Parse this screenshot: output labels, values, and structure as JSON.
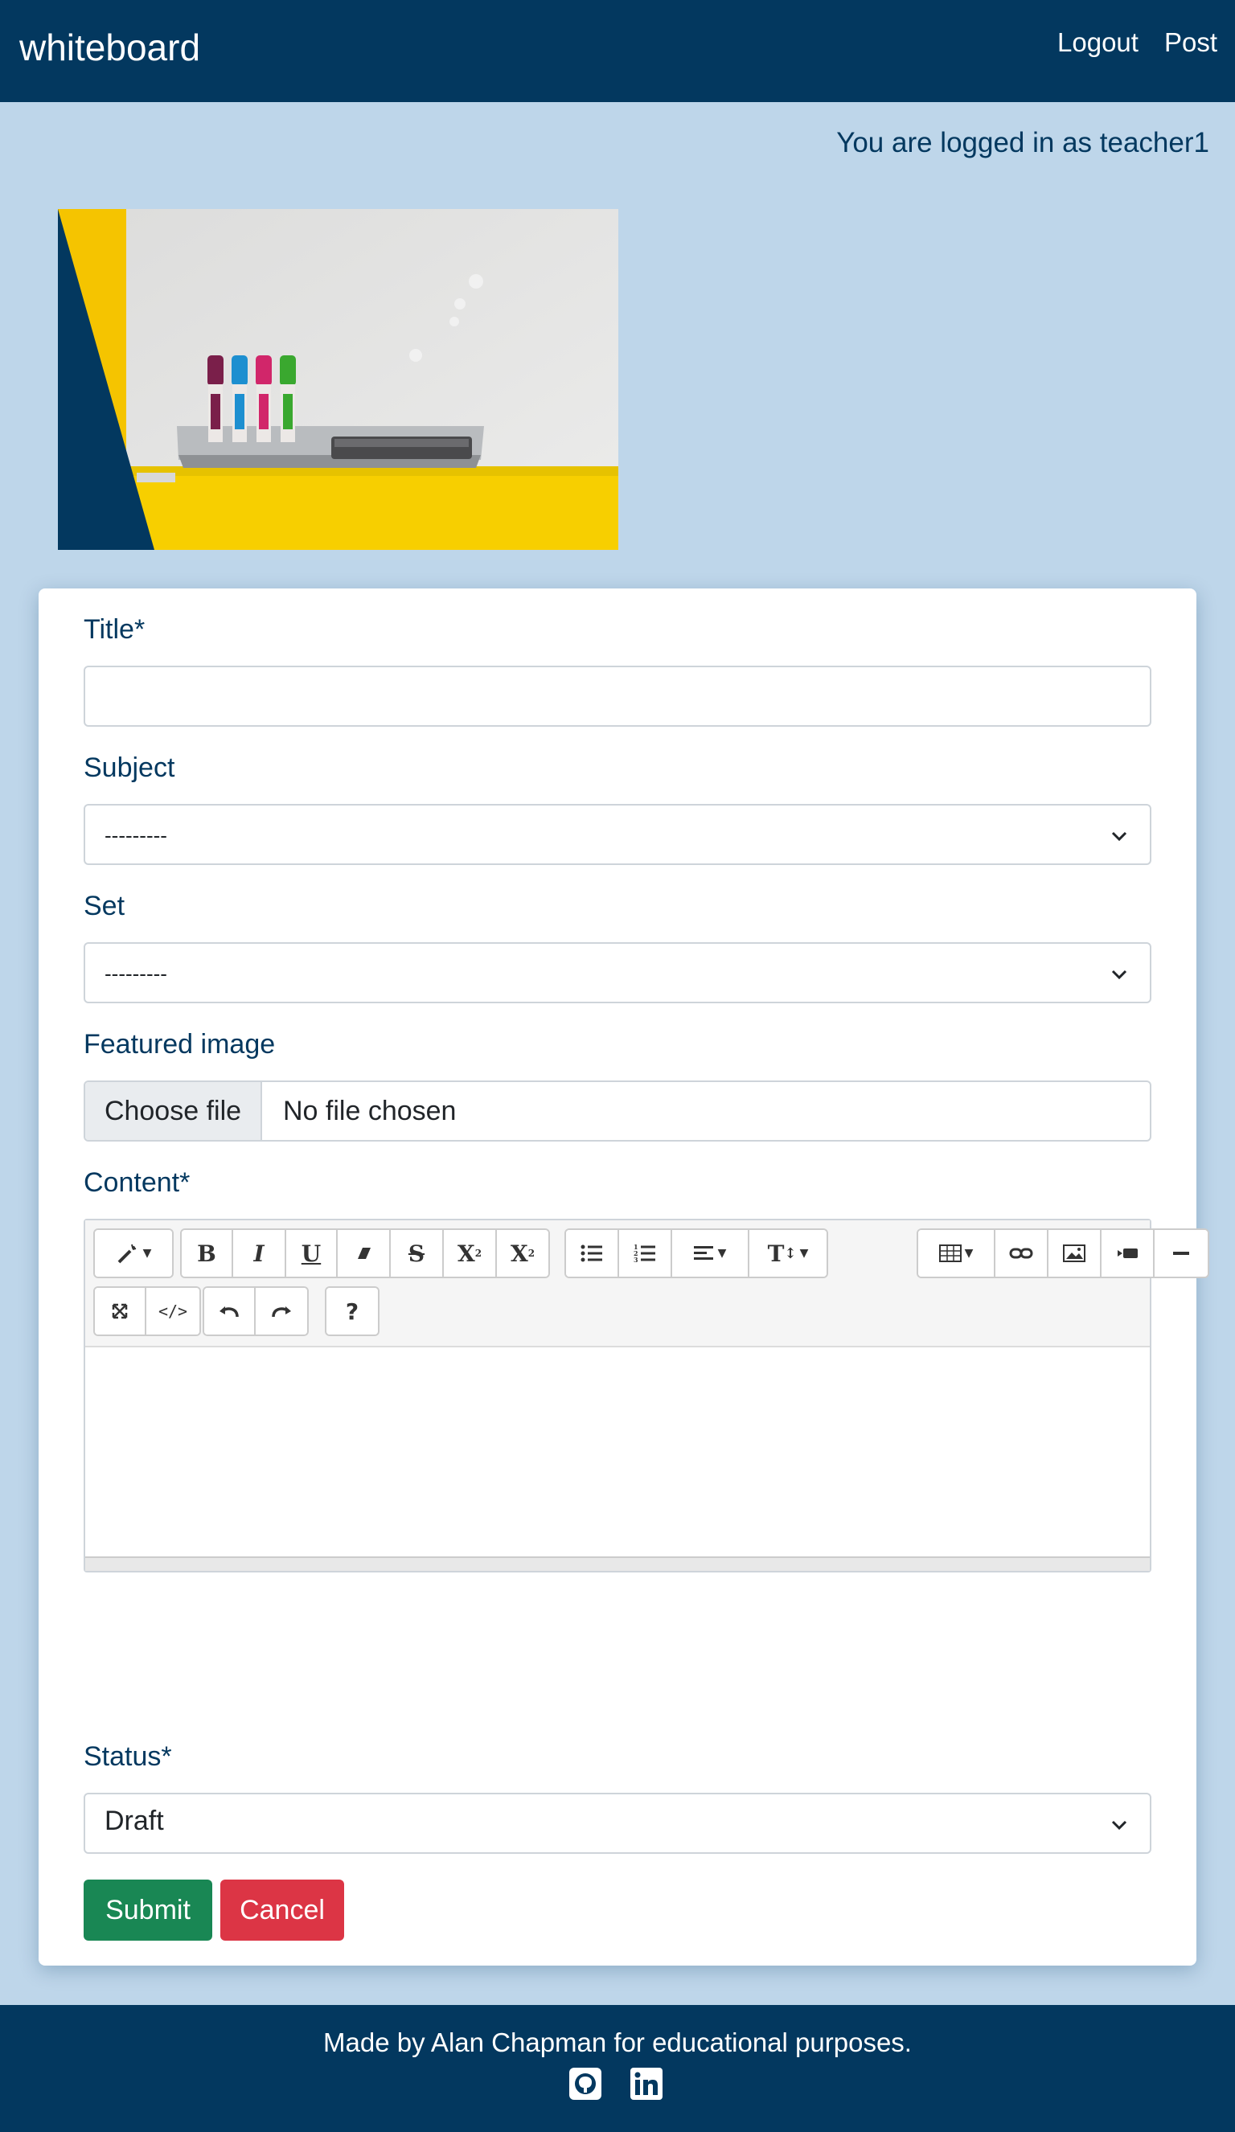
{
  "navbar": {
    "brand": "whiteboard",
    "links": [
      "Logout",
      "Post"
    ]
  },
  "user": {
    "logged_in_text": "You are logged in as teacher1"
  },
  "form": {
    "title_label": "Title*",
    "title_value": "",
    "subject_label": "Subject",
    "subject_selected": "---------",
    "set_label": "Set",
    "set_selected": "---------",
    "featured_image_label": "Featured image",
    "file_button": "Choose file",
    "file_status": "No file chosen",
    "content_label": "Content*",
    "status_label": "Status*",
    "status_selected": "Draft",
    "submit": "Submit",
    "cancel": "Cancel"
  },
  "toolbar": {
    "bold": "B",
    "italic": "I",
    "underline": "U",
    "strike": "S",
    "superscript": "X",
    "subscript": "X",
    "help": "?",
    "fontsize": "T"
  },
  "footer": {
    "text": "Made by Alan Chapman for educational purposes.",
    "icons": [
      "github-icon",
      "linkedin-icon"
    ]
  },
  "colors": {
    "primary": "#03385f",
    "background": "#bed6ea",
    "submit": "#198754",
    "cancel": "#dc3545"
  }
}
